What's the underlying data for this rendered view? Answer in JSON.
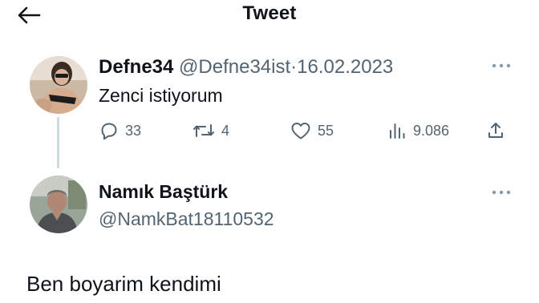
{
  "header": {
    "title": "Tweet",
    "back_icon": "arrow-left-icon"
  },
  "parent_tweet": {
    "display_name": "Defne34",
    "handle": "@Defne34ist",
    "separator": "·",
    "date": "16.02.2023",
    "text": "Zenci istiyorum",
    "stats": {
      "replies": "33",
      "retweets": "4",
      "likes": "55",
      "views": "9.086"
    },
    "icons": [
      "reply-icon",
      "retweet-icon",
      "like-icon",
      "views-icon",
      "share-icon",
      "more-icon"
    ]
  },
  "reply_tweet": {
    "display_name": "Namık Baştürk",
    "handle": "@NamkBat18110532",
    "text": "Ben boyarim kendimi"
  },
  "colors": {
    "text": "#0f1419",
    "secondary": "#536471",
    "thread_line": "#cfd9de",
    "background": "#ffffff"
  }
}
